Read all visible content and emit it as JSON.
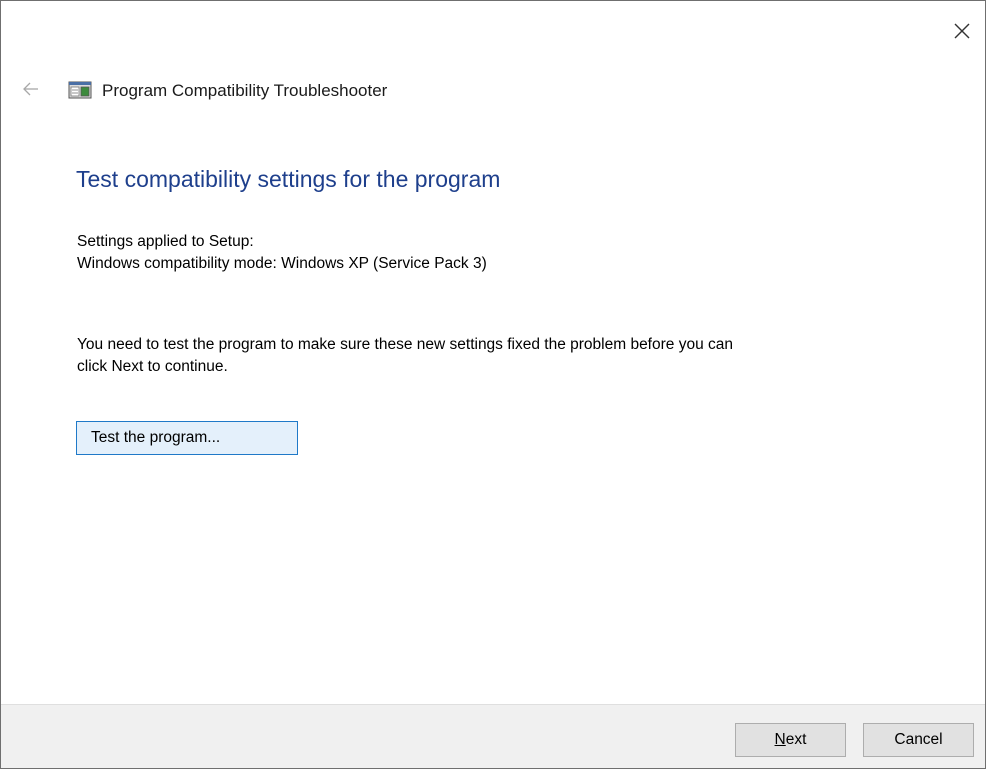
{
  "window": {
    "title": "Program Compatibility Troubleshooter",
    "close_icon": "close-icon",
    "back_icon": "back-arrow-icon",
    "app_icon": "troubleshooter-icon"
  },
  "page": {
    "heading": "Test compatibility settings for the program",
    "settings_applied": "Settings applied to Setup:",
    "compat_mode": "Windows compatibility mode: Windows XP (Service Pack 3)",
    "message_line1": "You need to test the program to make sure these new settings fixed the problem before you can",
    "message_line2": "click Next to continue.",
    "test_button_label": "Test the program..."
  },
  "footer": {
    "next_mnemonic": "N",
    "next_rest": "ext",
    "cancel_label": "Cancel"
  },
  "colors": {
    "heading": "#1e3f8c",
    "button_focus_border": "#1f79c8",
    "button_focus_bg": "#e4f0fb",
    "footer_bg": "#f0f0f0"
  }
}
